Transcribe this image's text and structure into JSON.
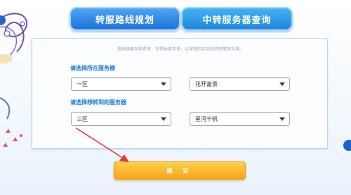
{
  "tabs": [
    {
      "label": "转服路线规划",
      "active": true
    },
    {
      "label": "中转服务器查询",
      "active": false
    }
  ],
  "panel": {
    "note": "查询结果仅供参考，仅供玩家参考，以游戏内实际的实时情况为准。",
    "groups": [
      {
        "label": "请选择所在服务器",
        "region": "一区",
        "server": "花开富贵"
      },
      {
        "label": "请选择想转到的服务器",
        "region": "三区",
        "server": "星河千帆"
      }
    ]
  },
  "confirm_label": "确 定",
  "colors": {
    "tab_blue": "#1d73d9",
    "label_blue": "#1e7bd8",
    "confirm_orange": "#f6a51c",
    "arrow_red": "#e23b3b"
  }
}
